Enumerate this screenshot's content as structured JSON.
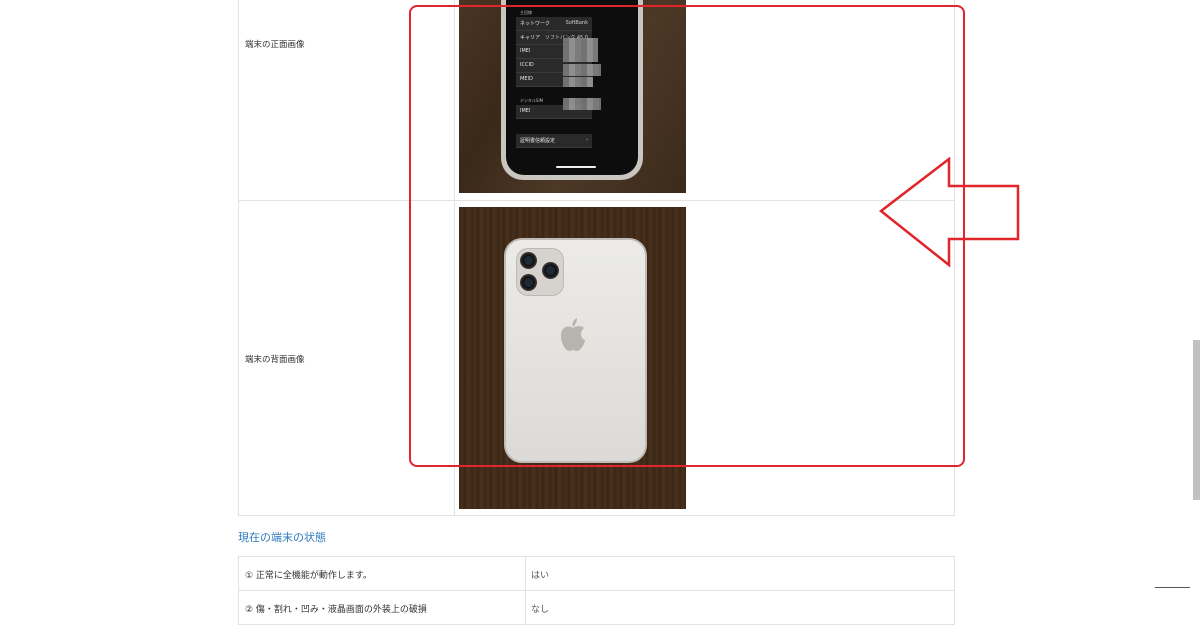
{
  "device_table": {
    "front_label": "端末の正面画像",
    "back_label": "端末の背面画像"
  },
  "phone_screen": {
    "section_label": "主回線",
    "rows": [
      {
        "key": "ネットワーク",
        "value": "SoftBank"
      },
      {
        "key": "キャリア",
        "value": "ソフトバンク 45.0"
      },
      {
        "key": "IMEI",
        "value": ""
      },
      {
        "key": "ICCID",
        "value": ""
      },
      {
        "key": "MEID",
        "value": ""
      }
    ],
    "esim_label": "デジタルSIM",
    "esim_row": {
      "key": "IMEI",
      "value": ""
    },
    "cert_button": "証明書信頼設定"
  },
  "status_section": {
    "title": "現在の端末の状態",
    "rows": [
      {
        "label": "① 正常に全機能が動作します。",
        "value": "はい"
      },
      {
        "label": "② 傷・割れ・凹み・液晶画面の外装上の破損",
        "value": "なし"
      }
    ]
  },
  "colors": {
    "annotation_red": "#e0252b",
    "section_title_blue": "#2f7bbf",
    "table_border": "#e2e2e2"
  }
}
